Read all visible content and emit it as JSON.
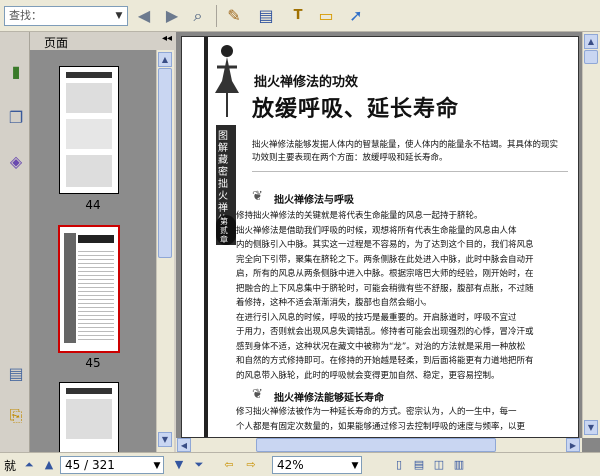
{
  "toolbar": {
    "search_placeholder": "查找：",
    "icons": [
      "back-icon",
      "forward-icon",
      "search-zoom-icon",
      "highlight-icon",
      "note-icon",
      "text-icon",
      "comment-icon",
      "arrow-icon"
    ]
  },
  "panel": {
    "title": "页面",
    "collapse": "◂◂"
  },
  "thumbnails": [
    {
      "page": "44",
      "title": "火禅修法的三种功法"
    },
    {
      "page": "45",
      "title": "放缓呼吸、延长寿命"
    },
    {
      "page": "",
      "title": "火禅修法的三种功法"
    }
  ],
  "document": {
    "subtitle": "拙火禅修法的功效",
    "title": "放缓呼吸、延长寿命",
    "side_label": "图解藏密拙火禅修",
    "chapter_label": "第贰章",
    "intro": "拙火禅修法能够发掘人体内的智慧能量，使人体内的能量永不枯竭。其具体的现实功效则主要表现在两个方面：放缓呼吸和延长寿命。",
    "section1_heading": "拙火禅修法与呼吸",
    "section1_lines": [
      "修持拙火禅修法的关键就是将代表生命能量的风息一起持于脐轮。",
      "拙火禅修法是借助我们呼吸的时候，观想将所有代表生命能量的风息由人体",
      "内的侧脉引入中脉。其实这一过程是不容易的，为了达到这个目的，我们将风息",
      "完全向下引带，聚集在脐轮之下。两条侧脉在此处进入中脉，此时中脉会自动开",
      "启，所有的风息从两条侧脉中进入中脉。根据宗喀巴大师的经验，刚开始时，在",
      "把融合的上下风息集中于脐轮时，可能会稍微有些不舒服，腹部有点胀，不过随",
      "着修持，这种不适会渐渐消失，腹部也自然会缩小。",
      "在进行引入风息的时候，呼吸的技巧是最重要的。开启脉道时，呼吸不宜过",
      "于用力，否则就会出现风息失调错乱。修持者可能会出现强烈的心悸，冒冷汗或",
      "感到身体不适，这种状况在藏文中被称为“龙”。对治的方法就是采用一种放松",
      "和自然的方式修持即可。在修持的开始越是轻柔，到后面将能更有力道地把所有",
      "的风息带入脉轮，此时的呼吸就会变得更加自然、稳定，更容易控制。"
    ],
    "section2_heading": "拙火禅修法能够延长寿命",
    "section2_lines": [
      "修习拙火禅修法被作为一种延长寿命的方式。密宗认为，人的一生中，每一",
      "个人都是有固定次数量的，如果能够通过修习去控制呼吸的速度与频率，以更"
    ]
  },
  "status": {
    "first_label": "就",
    "page_display": "45 / 321",
    "zoom": "42%"
  }
}
